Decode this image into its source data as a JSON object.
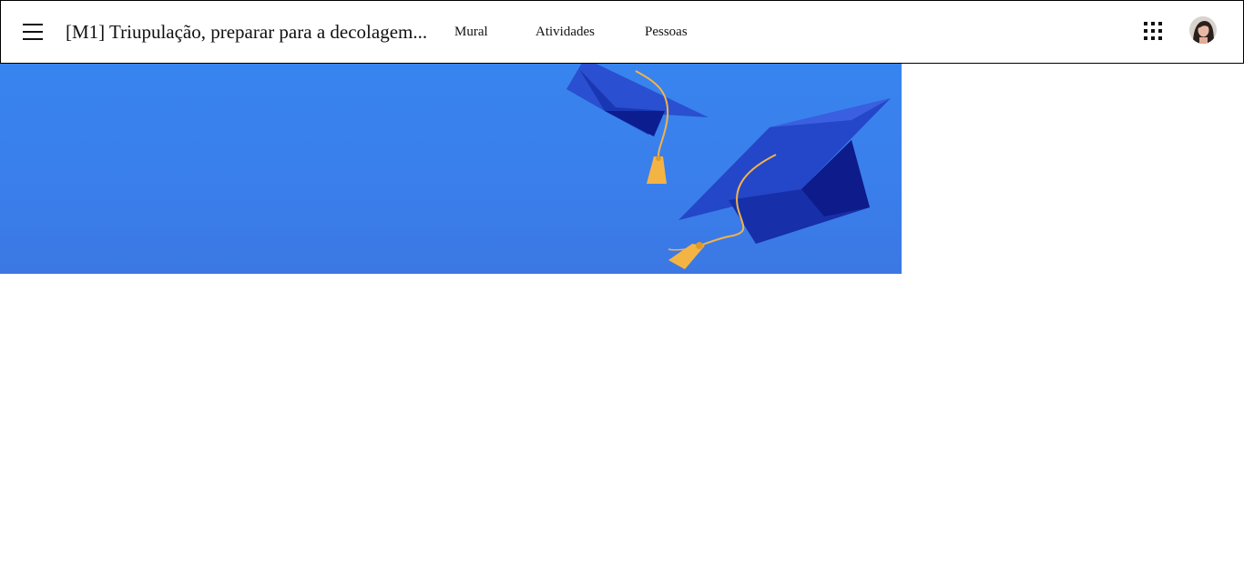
{
  "header": {
    "course_title": "[M1] Triupulação, preparar para a decolagem...",
    "tabs": [
      {
        "label": "Mural"
      },
      {
        "label": "Atividades"
      },
      {
        "label": "Pessoas"
      }
    ],
    "menu_icon": "hamburger-menu-icon",
    "apps_icon": "apps-grid-icon",
    "avatar_icon": "user-avatar"
  },
  "banner": {
    "theme": "graduation-caps",
    "colors": {
      "background": "#3884ef",
      "cap": "#1f3fc0",
      "cap_dark": "#0b1a8a",
      "tassel": "#f2b34a"
    }
  }
}
